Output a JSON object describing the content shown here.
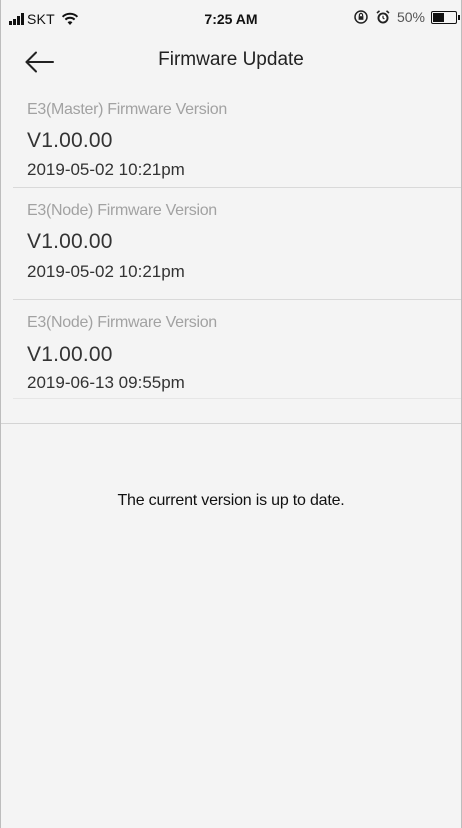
{
  "status_bar": {
    "carrier": "SKT",
    "time": "7:25 AM",
    "battery_percent": "50%",
    "battery_level": 0.5,
    "icons": [
      "signal-icon",
      "wifi-icon",
      "rotation-lock-icon",
      "alarm-icon",
      "battery-icon"
    ]
  },
  "nav": {
    "back_icon": "back-arrow-icon",
    "title": "Firmware Update"
  },
  "firmware": [
    {
      "name": "E3(Master) Firmware Version",
      "version": "V1.00.00",
      "date": "2019-05-02 10:21pm"
    },
    {
      "name": "E3(Node) Firmware Version",
      "version": "V1.00.00",
      "date": "2019-05-02 10:21pm"
    },
    {
      "name": "E3(Node) Firmware Version",
      "version": "V1.00.00",
      "date": "2019-06-13 09:55pm"
    }
  ],
  "message": "The current version is up to date.",
  "colors": {
    "background": "#f4f4f4",
    "label_gray": "#a2a2a2",
    "text_dark": "#333333",
    "divider": "#d9d9d9"
  }
}
